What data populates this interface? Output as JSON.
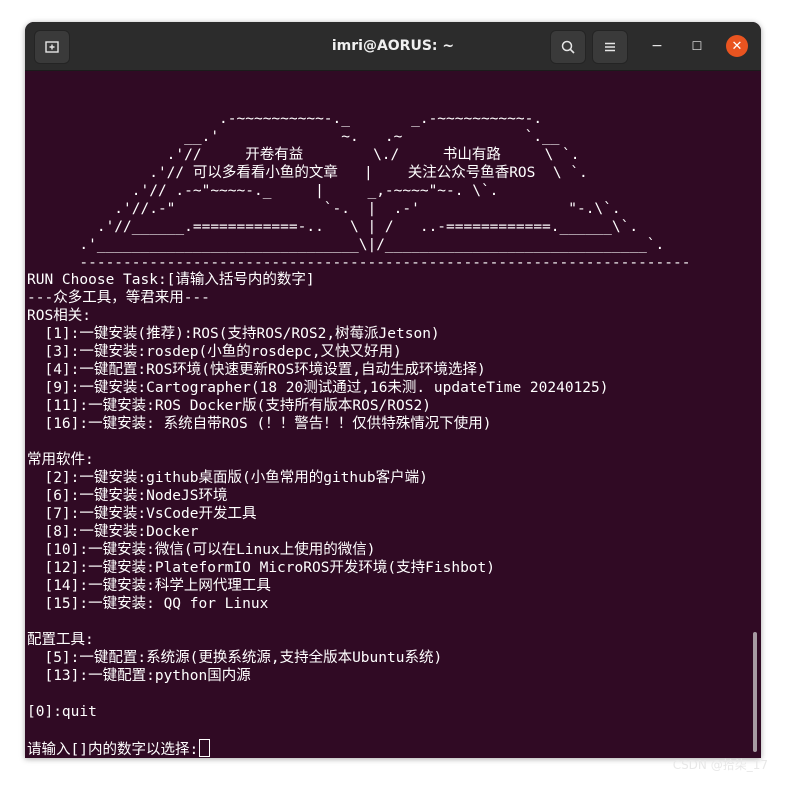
{
  "window": {
    "title": "imri@AORUS: ~",
    "buttons": {
      "new_tab_icon": "new-tab-icon",
      "search_icon": "search-icon",
      "menu_icon": "hamburger-menu-icon",
      "minimize_label": "−",
      "maximize_label": "☐",
      "close_label": "✕"
    },
    "colors": {
      "terminal_bg": "#300a24",
      "titlebar_bg": "#2c2c2c",
      "close_bg": "#e95420"
    }
  },
  "ascii_art": [
    "                      .-~~~~~~~~~~-._       _.-~~~~~~~~~~-.",
    "                  __.'              ~.   .~              `.__",
    "                .'//     开卷有益        \\./     书山有路     \\ `.",
    "              .'// 可以多看看小鱼的文章   |    关注公众号鱼香ROS  \\ `.",
    "            .'// .-~\"~~~~-._     |     _,-~~~~\"~-. \\`.",
    "          .'//.-\"                 `-.  |  .-'                 \"-.\\`.",
    "        .'//______.============-..   \\ | /   ..-============.______\\`.",
    "      .'______________________________\\|/______________________________`.",
    "      ----------------------------------------------------------------------"
  ],
  "menu": {
    "header_line": "RUN Choose Task:[请输入括号内的数字]",
    "subtitle": "---众多工具，等君来用---",
    "sections": [
      {
        "title": "ROS相关:",
        "items": [
          "  [1]:一键安装(推荐):ROS(支持ROS/ROS2,树莓派Jetson)",
          "  [3]:一键安装:rosdep(小鱼的rosdepc,又快又好用)",
          "  [4]:一键配置:ROS环境(快速更新ROS环境设置,自动生成环境选择)",
          "  [9]:一键安装:Cartographer(18 20测试通过,16未测. updateTime 20240125)",
          "  [11]:一键安装:ROS Docker版(支持所有版本ROS/ROS2)",
          "  [16]:一键安装: 系统自带ROS (！！警告！！仅供特殊情况下使用)"
        ]
      },
      {
        "title": "常用软件:",
        "items": [
          "  [2]:一键安装:github桌面版(小鱼常用的github客户端)",
          "  [6]:一键安装:NodeJS环境",
          "  [7]:一键安装:VsCode开发工具",
          "  [8]:一键安装:Docker",
          "  [10]:一键安装:微信(可以在Linux上使用的微信)",
          "  [12]:一键安装:PlateformIO MicroROS开发环境(支持Fishbot)",
          "  [14]:一键安装:科学上网代理工具",
          "  [15]:一键安装: QQ for Linux"
        ]
      },
      {
        "title": "配置工具:",
        "items": [
          "  [5]:一键配置:系统源(更换系统源,支持全版本Ubuntu系统)",
          "  [13]:一键配置:python国内源"
        ]
      }
    ],
    "quit_line": "[0]:quit",
    "prompt": "请输入[]内的数字以选择:"
  },
  "watermark": "CSDN @拾柒_17"
}
